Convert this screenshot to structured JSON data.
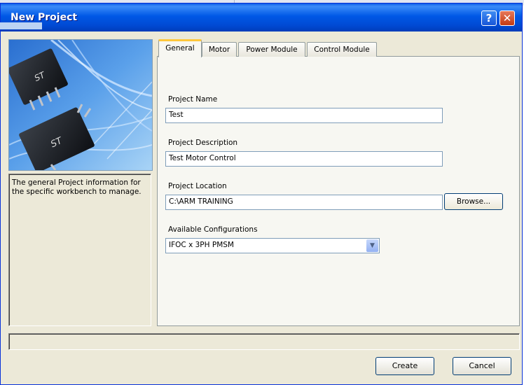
{
  "window": {
    "title": "New Project"
  },
  "titlebar": {
    "help_glyph": "?",
    "close_glyph": "✕"
  },
  "left_panel": {
    "description": "The general Project information for the specific workbench to manage."
  },
  "tabs": [
    {
      "label": "General",
      "active": true
    },
    {
      "label": "Motor",
      "active": false
    },
    {
      "label": "Power Module",
      "active": false
    },
    {
      "label": "Control Module",
      "active": false
    }
  ],
  "general": {
    "name_label": "Project Name",
    "name_value": "Test",
    "description_label": "Project Description",
    "description_value": "Test Motor Control",
    "location_label": "Project Location",
    "location_value": "C:\\ARM TRAINING",
    "browse_label": "Browse...",
    "config_label": "Available Configurations",
    "config_value": "IFOC x 3PH PMSM"
  },
  "buttons": {
    "create": "Create",
    "cancel": "Cancel"
  },
  "icons": {
    "help": "help-icon",
    "close": "close-icon",
    "dropdown": "chevron-down-icon"
  },
  "colors": {
    "titlebar": "#0058e6",
    "active_tab_accent": "#ffc73c",
    "face": "#ece9d8"
  }
}
